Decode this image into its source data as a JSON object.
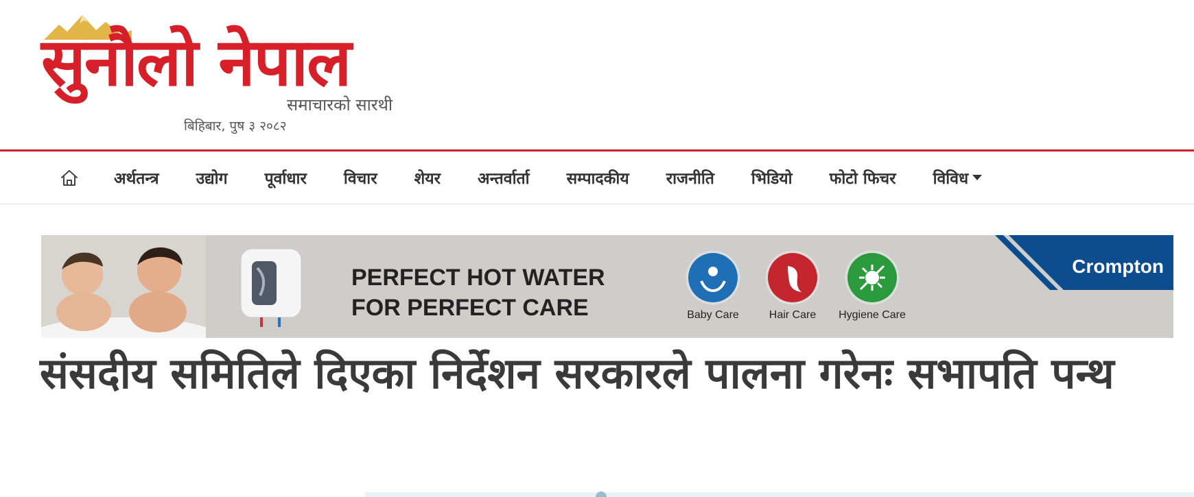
{
  "site": {
    "logo_text": "सुनौलो नेपाल",
    "tagline": "समाचारको सारथी",
    "date": "बिहिबार, पुष ३ २०८२",
    "brand_red": "#d71f2a"
  },
  "nav": {
    "home_icon": "home-icon",
    "items": [
      {
        "label": "अर्थतन्त्र"
      },
      {
        "label": "उद्योग"
      },
      {
        "label": "पूर्वाधार"
      },
      {
        "label": "विचार"
      },
      {
        "label": "शेयर"
      },
      {
        "label": "अन्तर्वार्ता"
      },
      {
        "label": "सम्पादकीय"
      },
      {
        "label": "राजनीति"
      },
      {
        "label": "भिडियो"
      },
      {
        "label": "फोटो फिचर"
      }
    ],
    "more_label": "विविध"
  },
  "ad": {
    "headline_line1": "PERFECT HOT WATER",
    "headline_line2": "FOR PERFECT CARE",
    "features": [
      {
        "label": "Baby Care",
        "color": "#1f6fb7"
      },
      {
        "label": "Hair Care",
        "color": "#c4262e"
      },
      {
        "label": "Hygiene Care",
        "color": "#2b9a3d"
      }
    ],
    "brand": "Crompton",
    "brand_color": "#0d4d8f"
  },
  "article": {
    "title": "संसदीय समितिले दिएका निर्देशन सरकारले पालना गरेनः सभापति पन्थ"
  }
}
